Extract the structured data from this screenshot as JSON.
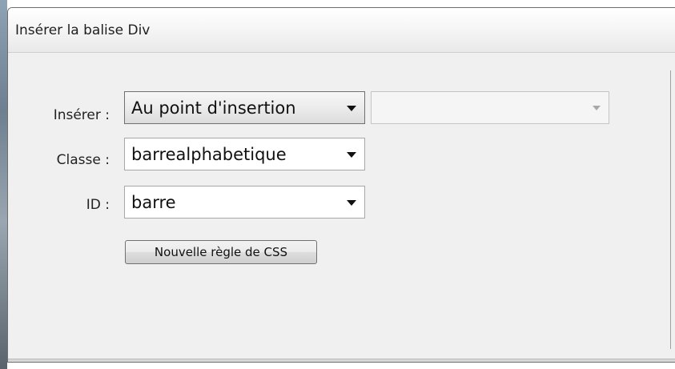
{
  "dialog": {
    "title": "Insérer la balise Div"
  },
  "form": {
    "insert": {
      "label": "Insérer :",
      "value": "Au point d'insertion"
    },
    "class": {
      "label": "Classe :",
      "value": "barrealphabetique"
    },
    "id": {
      "label": "ID :",
      "value": "barre"
    },
    "new_css_rule_button": "Nouvelle règle de CSS"
  }
}
